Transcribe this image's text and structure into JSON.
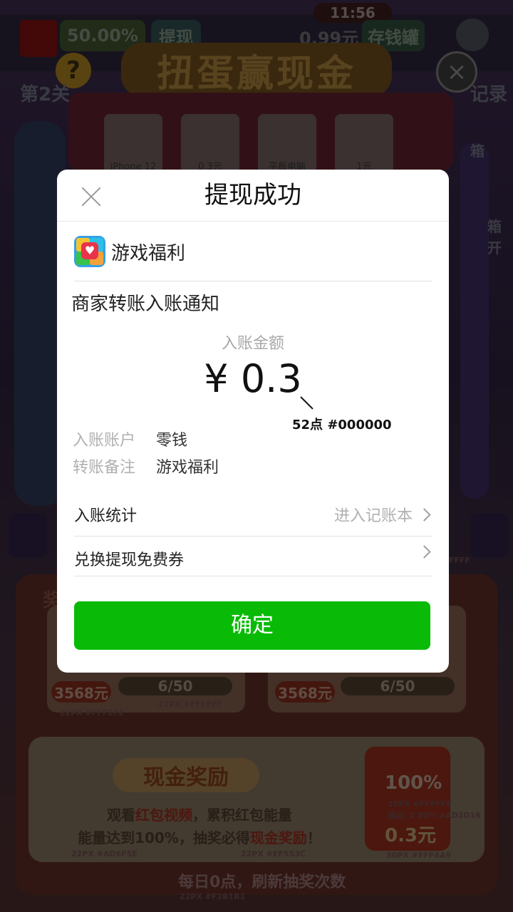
{
  "status_bar": {
    "time": "11:56"
  },
  "game": {
    "title": "扭蛋赢现金",
    "progress_text": "50.00%",
    "withdraw_btn": "提现",
    "balance_text": "0.99元",
    "piggy_btn": "存钱罐",
    "stage_text": "第2关",
    "records_text": "记录",
    "prize_labels": [
      "iPhone 12",
      "0.3元",
      "平板电脑",
      "1元"
    ],
    "right_labels": [
      "箱",
      "箱",
      "开"
    ],
    "bottom_section_title": "奖",
    "cards": [
      {
        "price": "3568元",
        "progress": "6/50"
      },
      {
        "price": "3568元",
        "progress": "6/50"
      }
    ],
    "cash_reward_title": "现金奖励",
    "cash_line1_a": "观看",
    "cash_line1_b": "红包视频",
    "cash_line1_c": "，累积红包能量",
    "cash_line2_a": "能量达到100%，抽奖必得",
    "cash_line2_b": "现金奖励",
    "cash_line2_c": "！",
    "jar_percent": "100%",
    "jar_value": "0.3元",
    "daily_text": "每日0点，刷新抽奖次数",
    "annotations": {
      "a1": "22PX #FFFEFE",
      "a2": "22PX #FFFFFF",
      "a3": "22PX #AD6F5E",
      "a4": "22PX #EF553C",
      "a5": "28PX #FFFFFF",
      "a5b": "描边: 2 50% #AD2D16",
      "a6": "30PX #FFF4A9",
      "a7": "22PX #F2B1B1",
      "a8": "FFFF"
    }
  },
  "modal": {
    "title": "提现成功",
    "app_name": "游戏福利",
    "notice": "商家转账入账通知",
    "amount_label": "入账金额",
    "amount": "¥ 0.3",
    "amount_annotation": "52点  #000000",
    "account_key": "入账账户",
    "account_value": "零钱",
    "remark_key": "转账备注",
    "remark_value": "游戏福利",
    "stats_label": "入账统计",
    "stats_link": "进入记账本",
    "coupon_label": "兑换提现免费券",
    "confirm": "确定"
  },
  "colors": {
    "confirm_green": "#09BB07",
    "modal_bg": "#FFFFFF"
  }
}
